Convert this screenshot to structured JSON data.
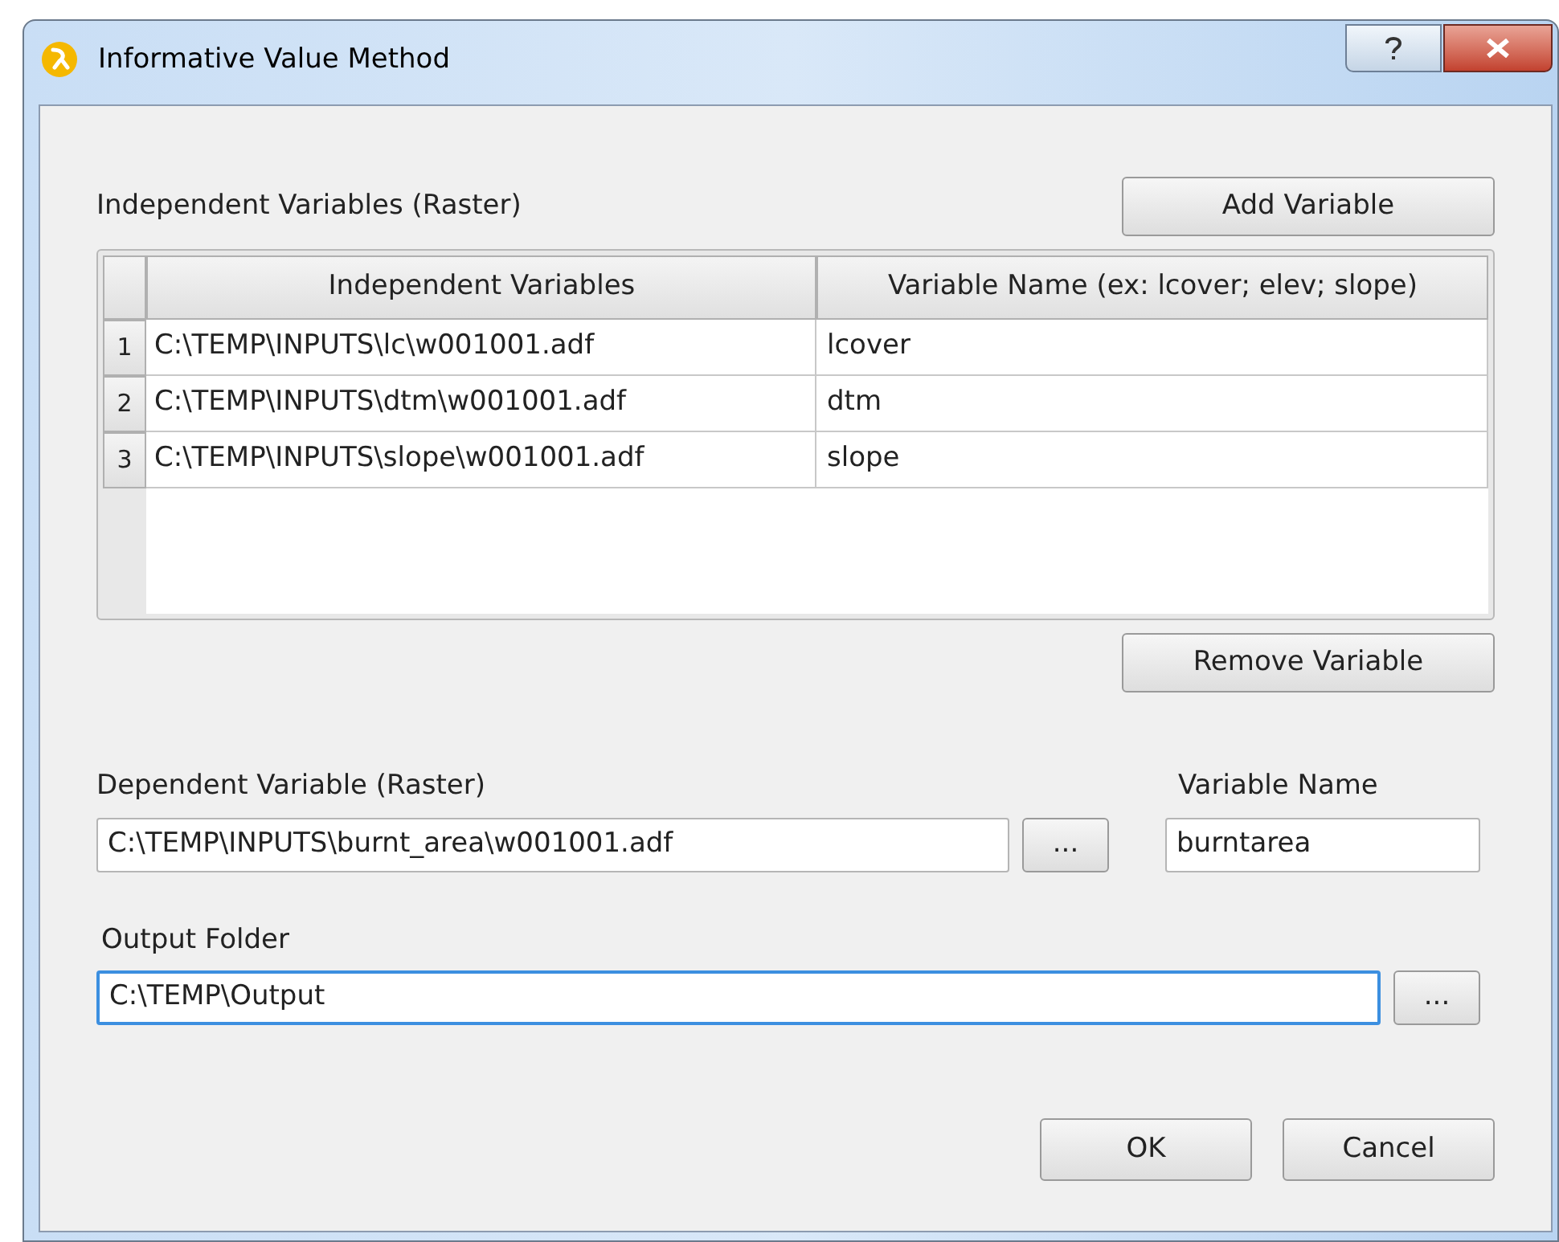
{
  "window": {
    "title": "Informative Value Method"
  },
  "independent": {
    "label": "Independent Variables (Raster)",
    "add_button": "Add Variable",
    "remove_button": "Remove Variable"
  },
  "table": {
    "columns": [
      "Independent Variables",
      "Variable Name (ex: lcover; elev; slope)"
    ],
    "rows": [
      {
        "number": "1",
        "path": "C:\\TEMP\\INPUTS\\lc\\w001001.adf",
        "name": "lcover"
      },
      {
        "number": "2",
        "path": "C:\\TEMP\\INPUTS\\dtm\\w001001.adf",
        "name": "dtm"
      },
      {
        "number": "3",
        "path": "C:\\TEMP\\INPUTS\\slope\\w001001.adf",
        "name": "slope"
      }
    ]
  },
  "dependent": {
    "label": "Dependent Variable (Raster)",
    "value": "C:\\TEMP\\INPUTS\\burnt_area\\w001001.adf",
    "browse_button": "...",
    "focused": false
  },
  "variable_name": {
    "label": "Variable Name",
    "value": "burntarea",
    "focused": false
  },
  "output": {
    "label": "Output Folder",
    "value": "C:\\TEMP\\Output",
    "browse_button": "...",
    "focused": true
  },
  "buttons": [
    "OK",
    "Cancel"
  ]
}
